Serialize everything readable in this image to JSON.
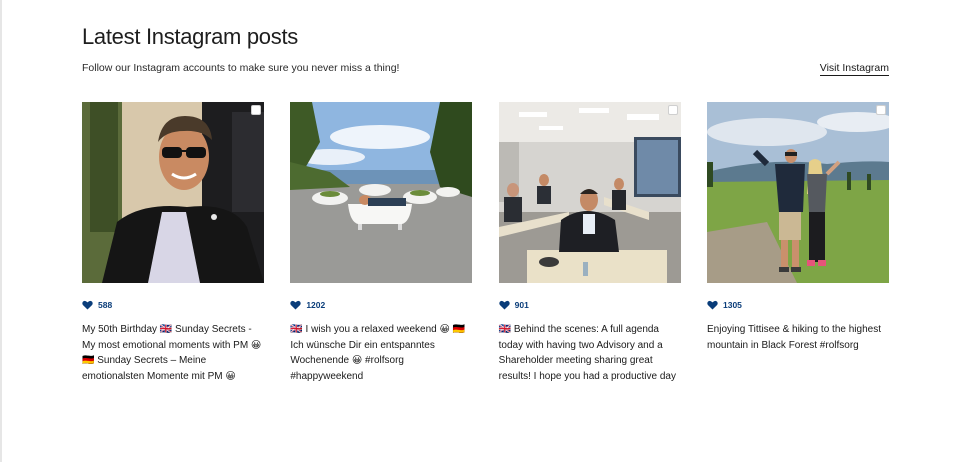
{
  "section": {
    "title": "Latest Instagram posts",
    "subtitle": "Follow our Instagram accounts to make sure you never miss a thing!",
    "visit_link": "Visit Instagram"
  },
  "posts": [
    {
      "likes": "588",
      "caption": "My 50th Birthday 🇬🇧 Sunday Secrets - My most emotional moments with PM 😀 🇩🇪 Sunday Secrets – Meine emotionalsten Momente mit PM 😀",
      "photo_icon": "profile-photo-icon"
    },
    {
      "likes": "1202",
      "caption": "🇬🇧 I wish you a relaxed weekend 😀 🇩🇪 Ich wünsche Dir ein entspanntes Wochenende 😀 #rolfsorg #happyweekend",
      "photo_icon": "bathtubs-photo-icon"
    },
    {
      "likes": "901",
      "caption": "🇬🇧 Behind the scenes: A full agenda today with having two Advisory and a Shareholder meeting sharing great results! I hope you had a productive day",
      "photo_icon": "meeting-photo-icon"
    },
    {
      "likes": "1305",
      "caption": "Enjoying Tittisee & hiking to the highest mountain in Black Forest #rolfsorg",
      "photo_icon": "hiking-photo-icon"
    }
  ],
  "colors": {
    "heart": "#0a3d7a",
    "text": "#1a1a1a"
  }
}
